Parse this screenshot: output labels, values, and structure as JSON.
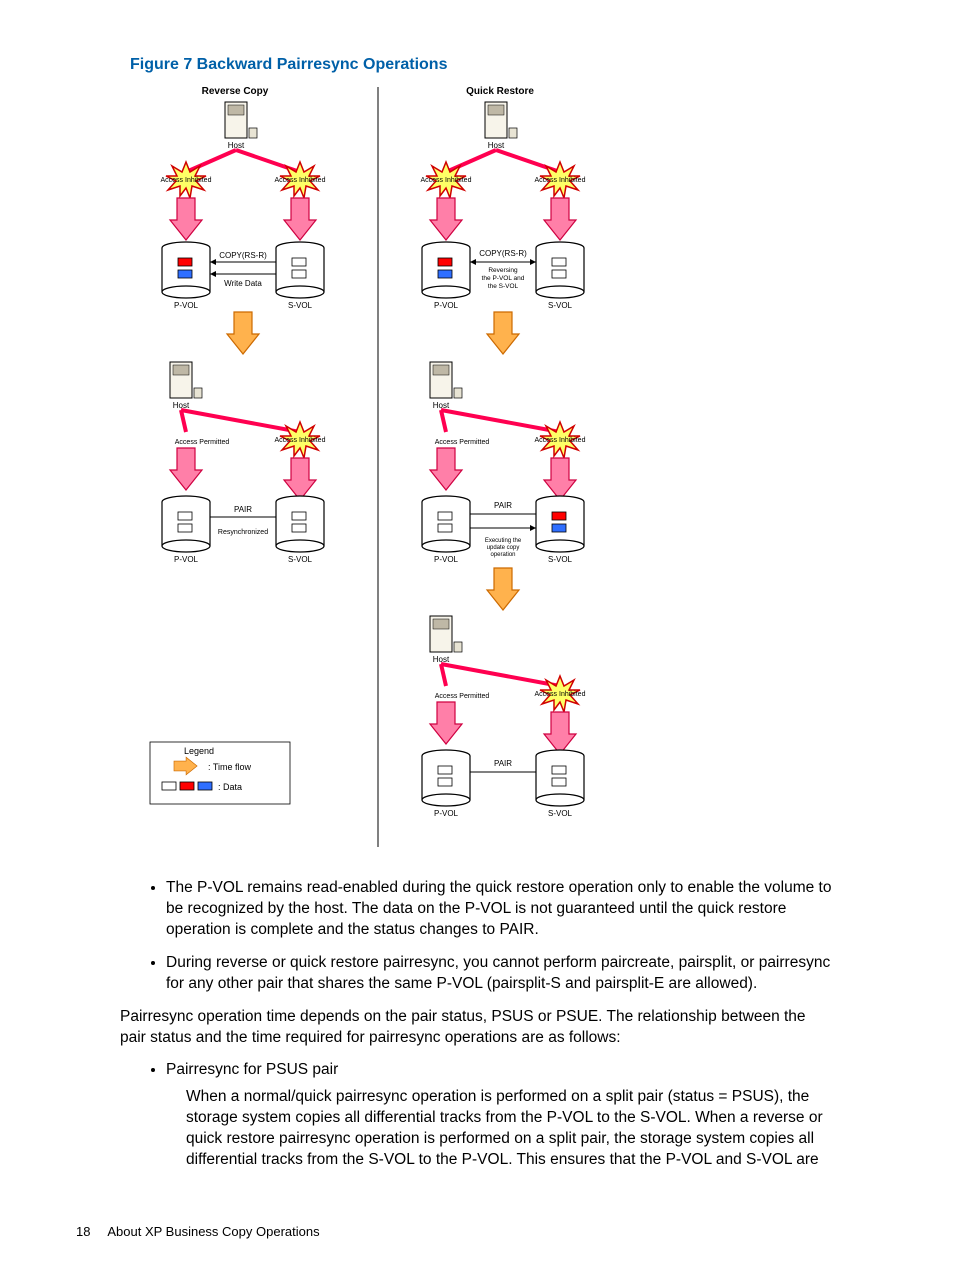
{
  "figure": {
    "title": "Figure 7 Backward Pairresync Operations",
    "left_title": "Reverse Copy",
    "right_title": "Quick Restore",
    "labels": {
      "host": "Host",
      "access_inhibited": "Access Inhibited",
      "access_permitted": "Access Permitted",
      "pvol": "P-VOL",
      "svol": "S-VOL",
      "copy_rsr": "COPY(RS-R)",
      "write_data": "Write Data",
      "reversing": "Reversing the P-VOL and the S-VOL",
      "pair": "PAIR",
      "resync": "Resynchronized",
      "exec_update": "Executing the update copy operation"
    },
    "legend": {
      "title": "Legend",
      "time_flow": ": Time flow",
      "data": ": Data"
    }
  },
  "bullets_a": [
    "The P-VOL remains read-enabled during the quick restore operation only to enable the volume to be recognized by the host. The data on the P-VOL is not guaranteed until the quick restore operation is complete and the status changes to PAIR.",
    "During reverse or quick restore pairresync, you cannot perform paircreate, pairsplit, or pairresync for any other pair that shares the same P-VOL (pairsplit-S and pairsplit-E are allowed)."
  ],
  "para_intro": "Pairresync operation time depends on the pair status, PSUS or PSUE. The relationship between the pair status and the time required for pairresync operations are as follows:",
  "bullet_b_lead": "Pairresync for PSUS pair",
  "bullet_b_body": "When a normal/quick pairresync operation is performed on a split pair (status = PSUS), the storage system copies all differential tracks from the P-VOL to the S-VOL. When a reverse or quick restore pairresync operation is performed on a split pair, the storage system copies all differential tracks from the S-VOL to the P-VOL. This ensures that the P-VOL and S-VOL are",
  "footer": {
    "page": "18",
    "section": "About XP Business Copy Operations"
  }
}
